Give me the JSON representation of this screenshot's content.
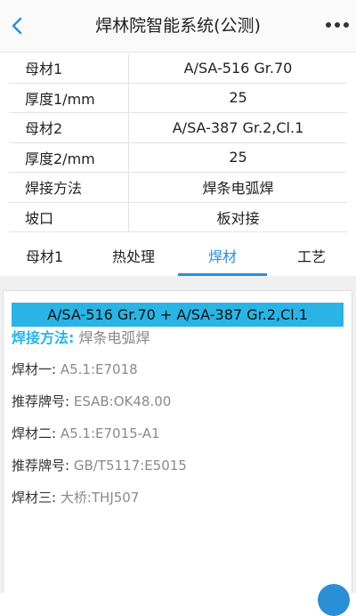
{
  "header": {
    "title": "焊林院智能系统(公测)"
  },
  "info": {
    "rows": [
      {
        "label": "母材1",
        "value": "A/SA-516 Gr.70"
      },
      {
        "label": "厚度1/mm",
        "value": "25"
      },
      {
        "label": "母材2",
        "value": "A/SA-387 Gr.2,Cl.1"
      },
      {
        "label": "厚度2/mm",
        "value": "25"
      },
      {
        "label": "焊接方法",
        "value": "焊条电弧焊"
      },
      {
        "label": "坡口",
        "value": "板对接"
      }
    ]
  },
  "tabs": [
    {
      "label": "母材1",
      "active": false
    },
    {
      "label": "热处理",
      "active": false
    },
    {
      "label": "焊材",
      "active": true
    },
    {
      "label": "工艺",
      "active": false
    }
  ],
  "card": {
    "material_pair": "A/SA-516 Gr.70 + A/SA-387 Gr.2,Cl.1",
    "weld_method_label": "焊接方法:",
    "weld_method_value": "焊条电弧焊",
    "details": [
      {
        "label": "焊材一:",
        "value": "A5.1:E7018"
      },
      {
        "label": "推荐牌号:",
        "value": "ESAB:OK48.00"
      },
      {
        "label": "焊材二:",
        "value": "A5.1:E7015-A1"
      },
      {
        "label": "推荐牌号:",
        "value": "GB/T5117:E5015"
      },
      {
        "label": "焊材三:",
        "value": "大桥:THJ507"
      }
    ]
  },
  "colors": {
    "accent": "#2b8fd6",
    "highlight_bar": "#2ab4e6"
  },
  "icons": {
    "back": "chevron-left-icon",
    "more": "more-dots-icon"
  }
}
